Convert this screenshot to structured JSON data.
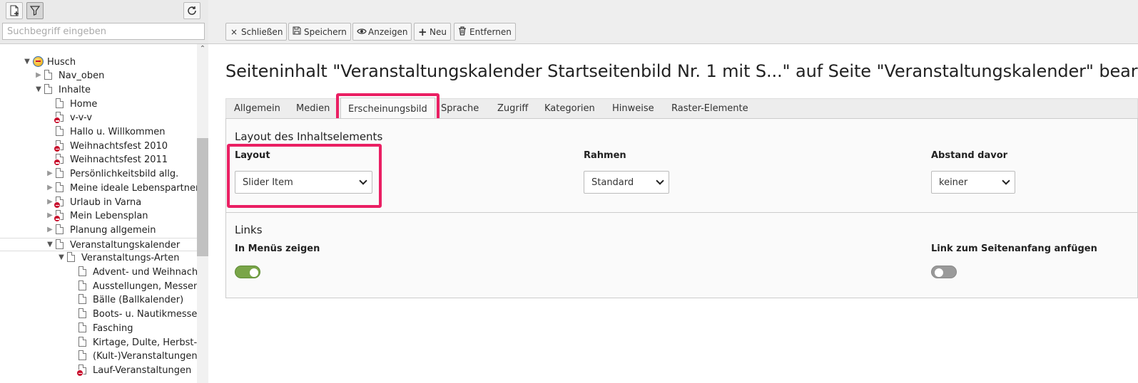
{
  "tree_search": {
    "placeholder": "Suchbegriff eingeben"
  },
  "tree": [
    {
      "label": "Husch",
      "level": 0,
      "toggle": "open",
      "icon": "globe"
    },
    {
      "label": "Nav_oben",
      "level": 1,
      "toggle": "closed",
      "icon": "page"
    },
    {
      "label": "Inhalte",
      "level": 1,
      "toggle": "open",
      "icon": "page"
    },
    {
      "label": "Home",
      "level": 2,
      "toggle": "none",
      "icon": "page"
    },
    {
      "label": "v-v-v",
      "level": 2,
      "toggle": "none",
      "icon": "page-hidden"
    },
    {
      "label": "Hallo u. Willkommen",
      "level": 2,
      "toggle": "none",
      "icon": "page"
    },
    {
      "label": "Weihnachtsfest 2010",
      "level": 2,
      "toggle": "none",
      "icon": "page-hidden"
    },
    {
      "label": "Weihnachtsfest 2011",
      "level": 2,
      "toggle": "none",
      "icon": "page-hidden"
    },
    {
      "label": "Persönlichkeitsbild allg.",
      "level": 2,
      "toggle": "closed",
      "icon": "page"
    },
    {
      "label": "Meine ideale Lebenspartnerin",
      "level": 2,
      "toggle": "closed",
      "icon": "page"
    },
    {
      "label": "Urlaub in Varna",
      "level": 2,
      "toggle": "closed",
      "icon": "page-hidden"
    },
    {
      "label": "Mein Lebensplan",
      "level": 2,
      "toggle": "closed",
      "icon": "page-hidden"
    },
    {
      "label": "Planung allgemein",
      "level": 2,
      "toggle": "closed",
      "icon": "page"
    },
    {
      "label": "Veranstaltungskalender",
      "level": 2,
      "toggle": "open",
      "icon": "page",
      "selected": true
    },
    {
      "label": "Veranstaltungs-Arten",
      "level": 3,
      "toggle": "open",
      "icon": "page"
    },
    {
      "label": "Advent- und Weihnachtsmärkte",
      "level": 4,
      "toggle": "none",
      "icon": "page"
    },
    {
      "label": "Ausstellungen, Messen",
      "level": 4,
      "toggle": "none",
      "icon": "page"
    },
    {
      "label": "Bälle (Ballkalender)",
      "level": 4,
      "toggle": "none",
      "icon": "page"
    },
    {
      "label": "Boots- u. Nautikmessen",
      "level": 4,
      "toggle": "none",
      "icon": "page"
    },
    {
      "label": "Fasching",
      "level": 4,
      "toggle": "none",
      "icon": "page"
    },
    {
      "label": "Kirtage, Dulte, Herbst- u.",
      "level": 4,
      "toggle": "none",
      "icon": "page"
    },
    {
      "label": "(Kult-)Veranstaltungen",
      "level": 4,
      "toggle": "none",
      "icon": "page"
    },
    {
      "label": "Lauf-Veranstaltungen",
      "level": 4,
      "toggle": "none",
      "icon": "page-hidden"
    }
  ],
  "docheader": {
    "buttons": [
      {
        "label": "Schließen",
        "icon": "×"
      },
      {
        "label": "Speichern",
        "icon": "💾"
      },
      {
        "label": "Anzeigen",
        "icon": "👁"
      },
      {
        "label": "Neu",
        "icon": "+"
      },
      {
        "label": "Entfernen",
        "icon": "🗑"
      }
    ]
  },
  "page_title": "Seiteninhalt \"Veranstaltungskalender Startseitenbild Nr. 1 mit S...\" auf Seite \"Veranstaltungskalender\" bearbeiten",
  "tabs": [
    "Allgemein",
    "Medien",
    "Erscheinungsbild",
    "Sprache",
    "Zugriff",
    "Kategorien",
    "Hinweise",
    "Raster-Elemente"
  ],
  "active_tab": "Erscheinungsbild",
  "layout_section": {
    "title": "Layout des Inhaltselements",
    "fields": [
      {
        "label": "Layout",
        "value": "Slider Item"
      },
      {
        "label": "Rahmen",
        "value": "Standard"
      },
      {
        "label": "Abstand davor",
        "value": "keiner"
      }
    ]
  },
  "links_section": {
    "title": "Links",
    "in_menus_label": "In Menüs zeigen",
    "in_menus_on": true,
    "link_top_label": "Link zum Seitenanfang anfügen",
    "link_top_on": false
  },
  "colors": {
    "highlight": "#ea1f63",
    "toggle_on": "#79a548",
    "toggle_off": "#9a9a9a",
    "hidden_badge": "#c8102e"
  }
}
